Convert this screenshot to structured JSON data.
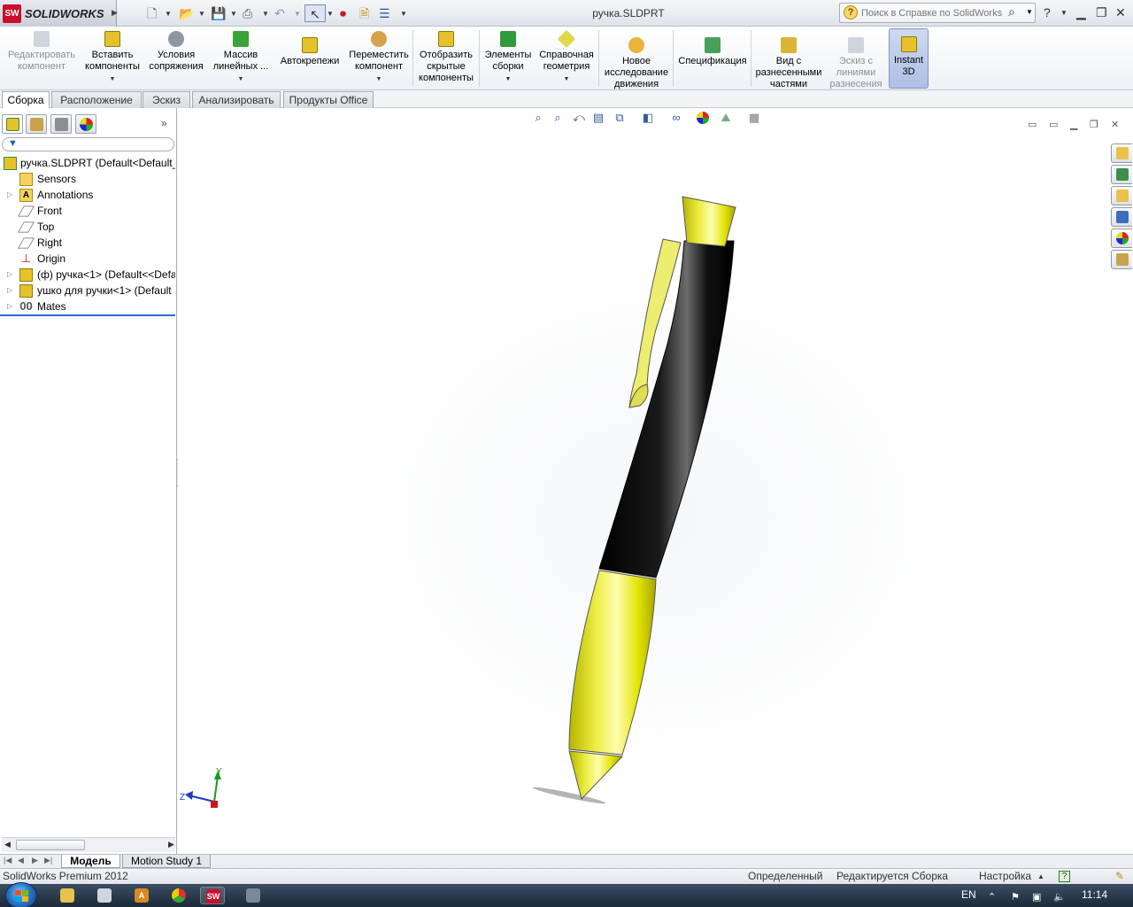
{
  "titlebar": {
    "app_name": "SOLIDWORKS",
    "app_badge": "SW",
    "doc_title": "ручка.SLDPRT",
    "help_search_placeholder": "Поиск в Справке по SolidWorks",
    "help_label": "?",
    "quick_access": [
      "new-document-icon",
      "open-icon",
      "save-icon",
      "print-icon",
      "undo-icon",
      "select-icon",
      "rebuild-icon",
      "file-properties-icon",
      "options-icon"
    ]
  },
  "commands": [
    {
      "id": "edit-component",
      "label": "Редактировать компонент",
      "disabled": true
    },
    {
      "id": "insert-components",
      "label": "Вставить компоненты",
      "dropdown": true
    },
    {
      "id": "mate",
      "label": "Условия сопряжения"
    },
    {
      "id": "linear-pattern",
      "label": "Массив линейных ...",
      "dropdown": true
    },
    {
      "id": "smart-fasteners",
      "label": "Автокрепежи"
    },
    {
      "id": "move-component",
      "label": "Переместить компонент",
      "dropdown": true
    },
    {
      "id": "show-hidden",
      "label": "Отобразить скрытые компоненты"
    },
    {
      "id": "assembly-features",
      "label": "Элементы сборки",
      "dropdown": true
    },
    {
      "id": "reference-geometry",
      "label": "Справочная геометрия",
      "dropdown": true
    },
    {
      "id": "new-motion-study",
      "label": "Новое исследование движения"
    },
    {
      "id": "bill-of-materials",
      "label": "Спецификация"
    },
    {
      "id": "exploded-view",
      "label": "Вид с разнесенными частями"
    },
    {
      "id": "explode-line-sketch",
      "label": "Эскиз с линиями разнесения",
      "disabled": true
    },
    {
      "id": "instant-3d",
      "label": "Instant 3D",
      "active": true
    }
  ],
  "tabs": [
    "Сборка",
    "Расположение",
    "Эскиз",
    "Анализировать",
    "Продукты Office"
  ],
  "active_tab": "Сборка",
  "feature_tree": {
    "root": "ручка.SLDPRT  (Default<Default_",
    "items": [
      {
        "label": "Sensors",
        "icon": "sensor-icon",
        "expandable": false
      },
      {
        "label": "Annotations",
        "icon": "annotations-icon",
        "expandable": true
      },
      {
        "label": "Front",
        "icon": "plane-icon",
        "expandable": false
      },
      {
        "label": "Top",
        "icon": "plane-icon",
        "expandable": false
      },
      {
        "label": "Right",
        "icon": "plane-icon",
        "expandable": false
      },
      {
        "label": "Origin",
        "icon": "origin-icon",
        "expandable": false
      },
      {
        "label": "(ф) ручка<1> (Default<<Defa",
        "icon": "part-icon",
        "expandable": true
      },
      {
        "label": "ушко для ручки<1> (Default",
        "icon": "part-icon",
        "expandable": true
      },
      {
        "label": "Mates",
        "icon": "mates-icon",
        "expandable": true
      }
    ]
  },
  "triad": {
    "y": "Y",
    "z": "Z"
  },
  "bottom_tabs": [
    "Модель",
    "Motion Study 1"
  ],
  "status": {
    "product": "SolidWorks Premium 2012",
    "state": "Определенный",
    "mode": "Редактируется Сборка",
    "customize": "Настройка",
    "help": "?"
  },
  "taskbar": {
    "lang": "EN",
    "time": "11:14"
  },
  "colors": {
    "accent": "#2d6dc9",
    "pen_black": "#0b0b0b",
    "pen_yellow": "#e8e800",
    "sw_red": "#c8102e"
  }
}
